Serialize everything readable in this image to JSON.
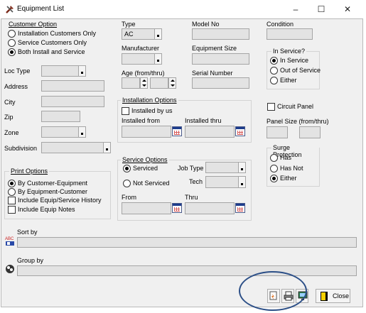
{
  "window": {
    "title": "Equipment List",
    "controls": {
      "minimize": "–",
      "maximize": "☐",
      "close": "✕"
    }
  },
  "customer_option": {
    "label": "Customer Option",
    "options": [
      "Installation Customers Only",
      "Service Customers Only",
      "Both Install and Service"
    ],
    "selected": 2
  },
  "left_fields": {
    "loc_type": "Loc Type",
    "address": "Address",
    "city": "City",
    "zip": "Zip",
    "zone": "Zone",
    "subdivision": "Subdivision"
  },
  "print_options": {
    "label": "Print Options",
    "options": [
      "By Customer-Equipment",
      "By Equipment-Customer"
    ],
    "selected": 0,
    "checks": [
      "Include Equip/Service History",
      "Include Equip Notes"
    ]
  },
  "type": {
    "label": "Type",
    "value": "AC"
  },
  "model_no": {
    "label": "Model No"
  },
  "condition": {
    "label": "Condition"
  },
  "manufacturer": {
    "label": "Manufacturer"
  },
  "equipment_size": {
    "label": "Equipment Size"
  },
  "age": {
    "label": "Age (from/thru)"
  },
  "serial_number": {
    "label": "Serial Number"
  },
  "in_service": {
    "label": "In Service?",
    "options": [
      "In Service",
      "Out of Service",
      "Either"
    ],
    "selected": 0
  },
  "installation_options": {
    "label": "Installation Options",
    "installed_by_us": "Installed by us",
    "installed_from": "Installed from",
    "installed_thru": "Installed thru"
  },
  "circuit_panel": {
    "label": "Circuit Panel"
  },
  "panel_size": {
    "label": "Panel Size (from/thru)"
  },
  "service_options": {
    "label": "Service Options",
    "options": [
      "Serviced",
      "Not Serviced"
    ],
    "selected": 0,
    "job_type": "Job Type",
    "tech": "Tech",
    "from": "From",
    "thru": "Thru"
  },
  "surge_protection": {
    "label": "Surge Protection",
    "options": [
      "Has",
      "Has Not",
      "Either"
    ],
    "selected": 2
  },
  "sort_by": {
    "label": "Sort by"
  },
  "group_by": {
    "label": "Group by"
  },
  "toolbar": {
    "close_label": "Close"
  },
  "icons": {
    "title": "tools-icon",
    "sort": "sort-abc-icon",
    "group": "group-icon",
    "preview": "preview-report-icon",
    "print": "printer-icon",
    "export": "export-screen-icon",
    "close": "door-exit-icon"
  }
}
